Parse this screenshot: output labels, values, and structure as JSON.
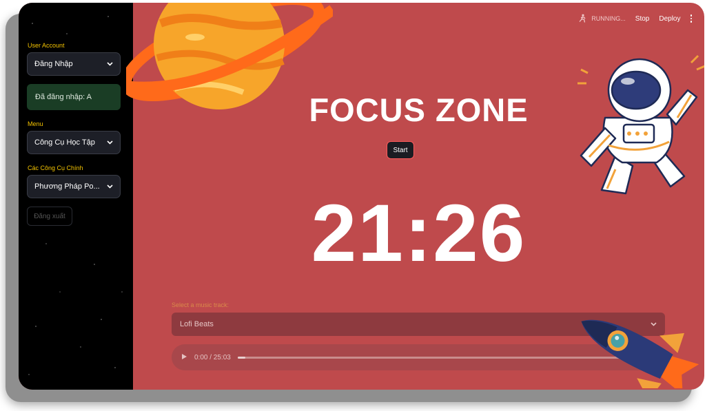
{
  "sidebar": {
    "account_label": "User Account",
    "account_select": "Đăng Nhập",
    "login_status": "Đã đăng nhập: A",
    "menu_label": "Menu",
    "menu_select": "Công Cụ Học Tập",
    "tools_label": "Các Công Cụ Chính",
    "tools_select": "Phương Pháp Po...",
    "logout_button": "Đăng xuất"
  },
  "topbar": {
    "status": "RUNNING...",
    "stop": "Stop",
    "deploy": "Deploy"
  },
  "main": {
    "title": "FOCUS ZONE",
    "start_button": "Start",
    "timer": "21:26",
    "music_label": "Select a music track:",
    "music_select": "Lofi Beats",
    "audio_time": "0:00 / 25:03",
    "audio_progress": 0.02
  },
  "colors": {
    "background": "#bf4a4c",
    "sidebar": "#000000",
    "accent_label": "#f5c400",
    "success_bg": "#1a3d25"
  }
}
